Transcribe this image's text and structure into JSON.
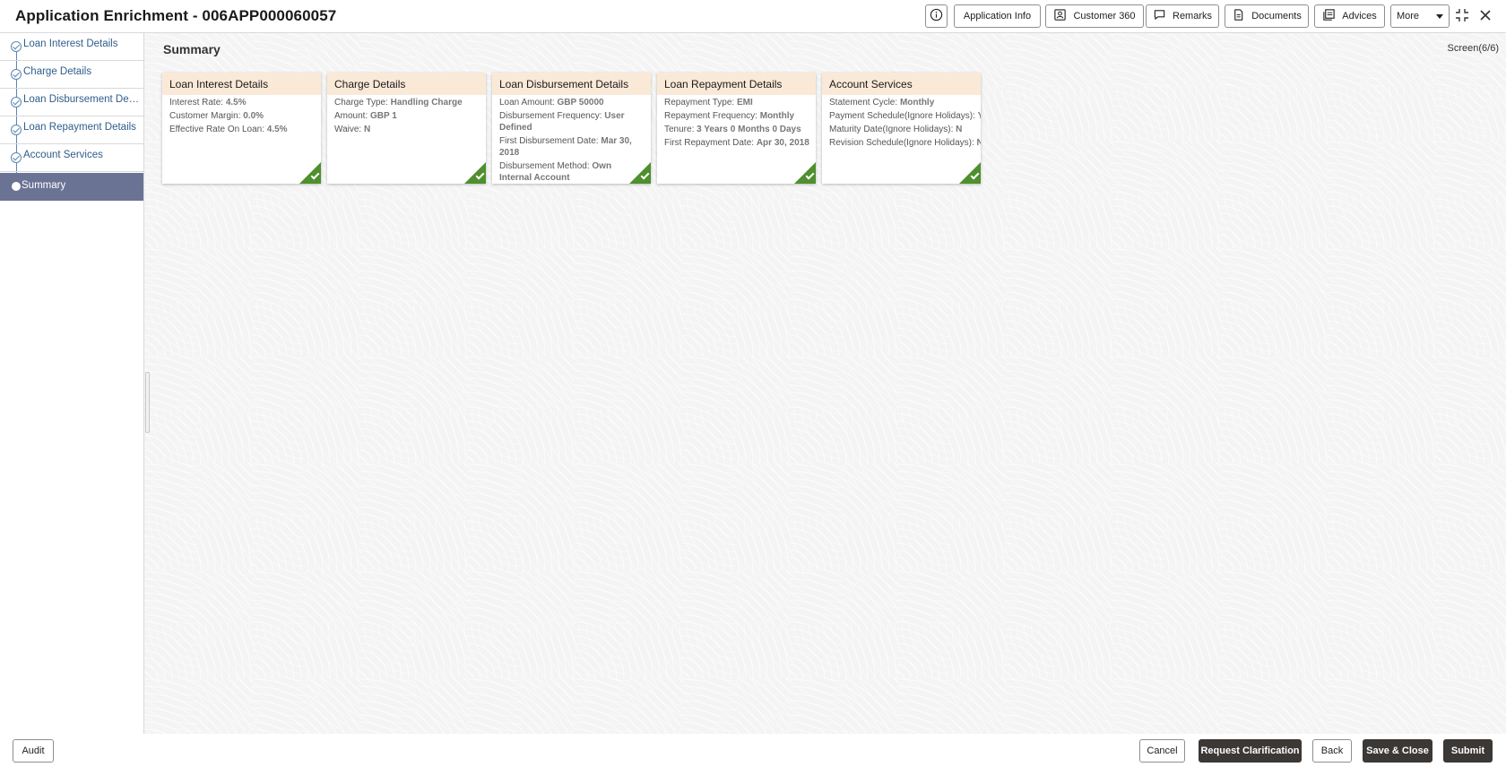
{
  "header": {
    "title": "Application Enrichment - 006APP000060057",
    "buttons": {
      "application_info": "Application Info",
      "customer_360": "Customer 360",
      "remarks": "Remarks",
      "documents": "Documents",
      "advices": "Advices",
      "more": "More"
    }
  },
  "sidebar": {
    "items": [
      {
        "label": "Loan Interest Details",
        "status": "completed"
      },
      {
        "label": "Charge Details",
        "status": "completed"
      },
      {
        "label": "Loan Disbursement Details",
        "status": "completed"
      },
      {
        "label": "Loan Repayment Details",
        "status": "completed"
      },
      {
        "label": "Account Services",
        "status": "completed"
      },
      {
        "label": "Summary",
        "status": "current"
      }
    ]
  },
  "main": {
    "title": "Summary",
    "screen_counter": "Screen(6/6)",
    "cards": [
      {
        "title": "Loan Interest Details",
        "rows": [
          {
            "label": "Interest Rate:",
            "value": "4.5%"
          },
          {
            "label": "Customer Margin:",
            "value": "0.0%"
          },
          {
            "label": "Effective Rate On Loan:",
            "value": "4.5%"
          }
        ]
      },
      {
        "title": "Charge Details",
        "rows": [
          {
            "label": "Charge Type:",
            "value": "Handling Charge"
          },
          {
            "label": "Amount:",
            "value": "GBP 1"
          },
          {
            "label": "Waive:",
            "value": "N"
          }
        ]
      },
      {
        "title": "Loan Disbursement Details",
        "rows": [
          {
            "label": "Loan Amount:",
            "value": "GBP 50000"
          },
          {
            "label": "Disbursement Frequency:",
            "value": "User Defined"
          },
          {
            "label": "First Disbursement Date:",
            "value": "Mar 30, 2018"
          },
          {
            "label": "Disbursement Method:",
            "value": "Own Internal Account"
          }
        ]
      },
      {
        "title": "Loan Repayment Details",
        "rows": [
          {
            "label": "Repayment Type:",
            "value": "EMI"
          },
          {
            "label": "Repayment Frequency:",
            "value": "Monthly"
          },
          {
            "label": "Tenure:",
            "value": "3 Years 0 Months 0 Days"
          },
          {
            "label": "First Repayment Date:",
            "value": "Apr 30, 2018"
          }
        ]
      },
      {
        "title": "Account Services",
        "rows": [
          {
            "label": "Statement Cycle:",
            "value": "Monthly"
          },
          {
            "label": "Payment Schedule(Ignore Holidays):",
            "value": "Y"
          },
          {
            "label": "Maturity Date(Ignore Holidays):",
            "value": "N"
          },
          {
            "label": "Revision Schedule(Ignore Holidays):",
            "value": "N"
          }
        ]
      }
    ]
  },
  "footer": {
    "audit": "Audit",
    "cancel": "Cancel",
    "request_clarification": "Request Clarification",
    "back": "Back",
    "save_close": "Save & Close",
    "submit": "Submit"
  },
  "colors": {
    "card_header_bg": "#fbe9d8",
    "completed_tick": "#4e8f2e",
    "active_nav_bg": "#6b7394",
    "primary_button": "#3c3836",
    "nav_link": "#2f5d8a"
  }
}
